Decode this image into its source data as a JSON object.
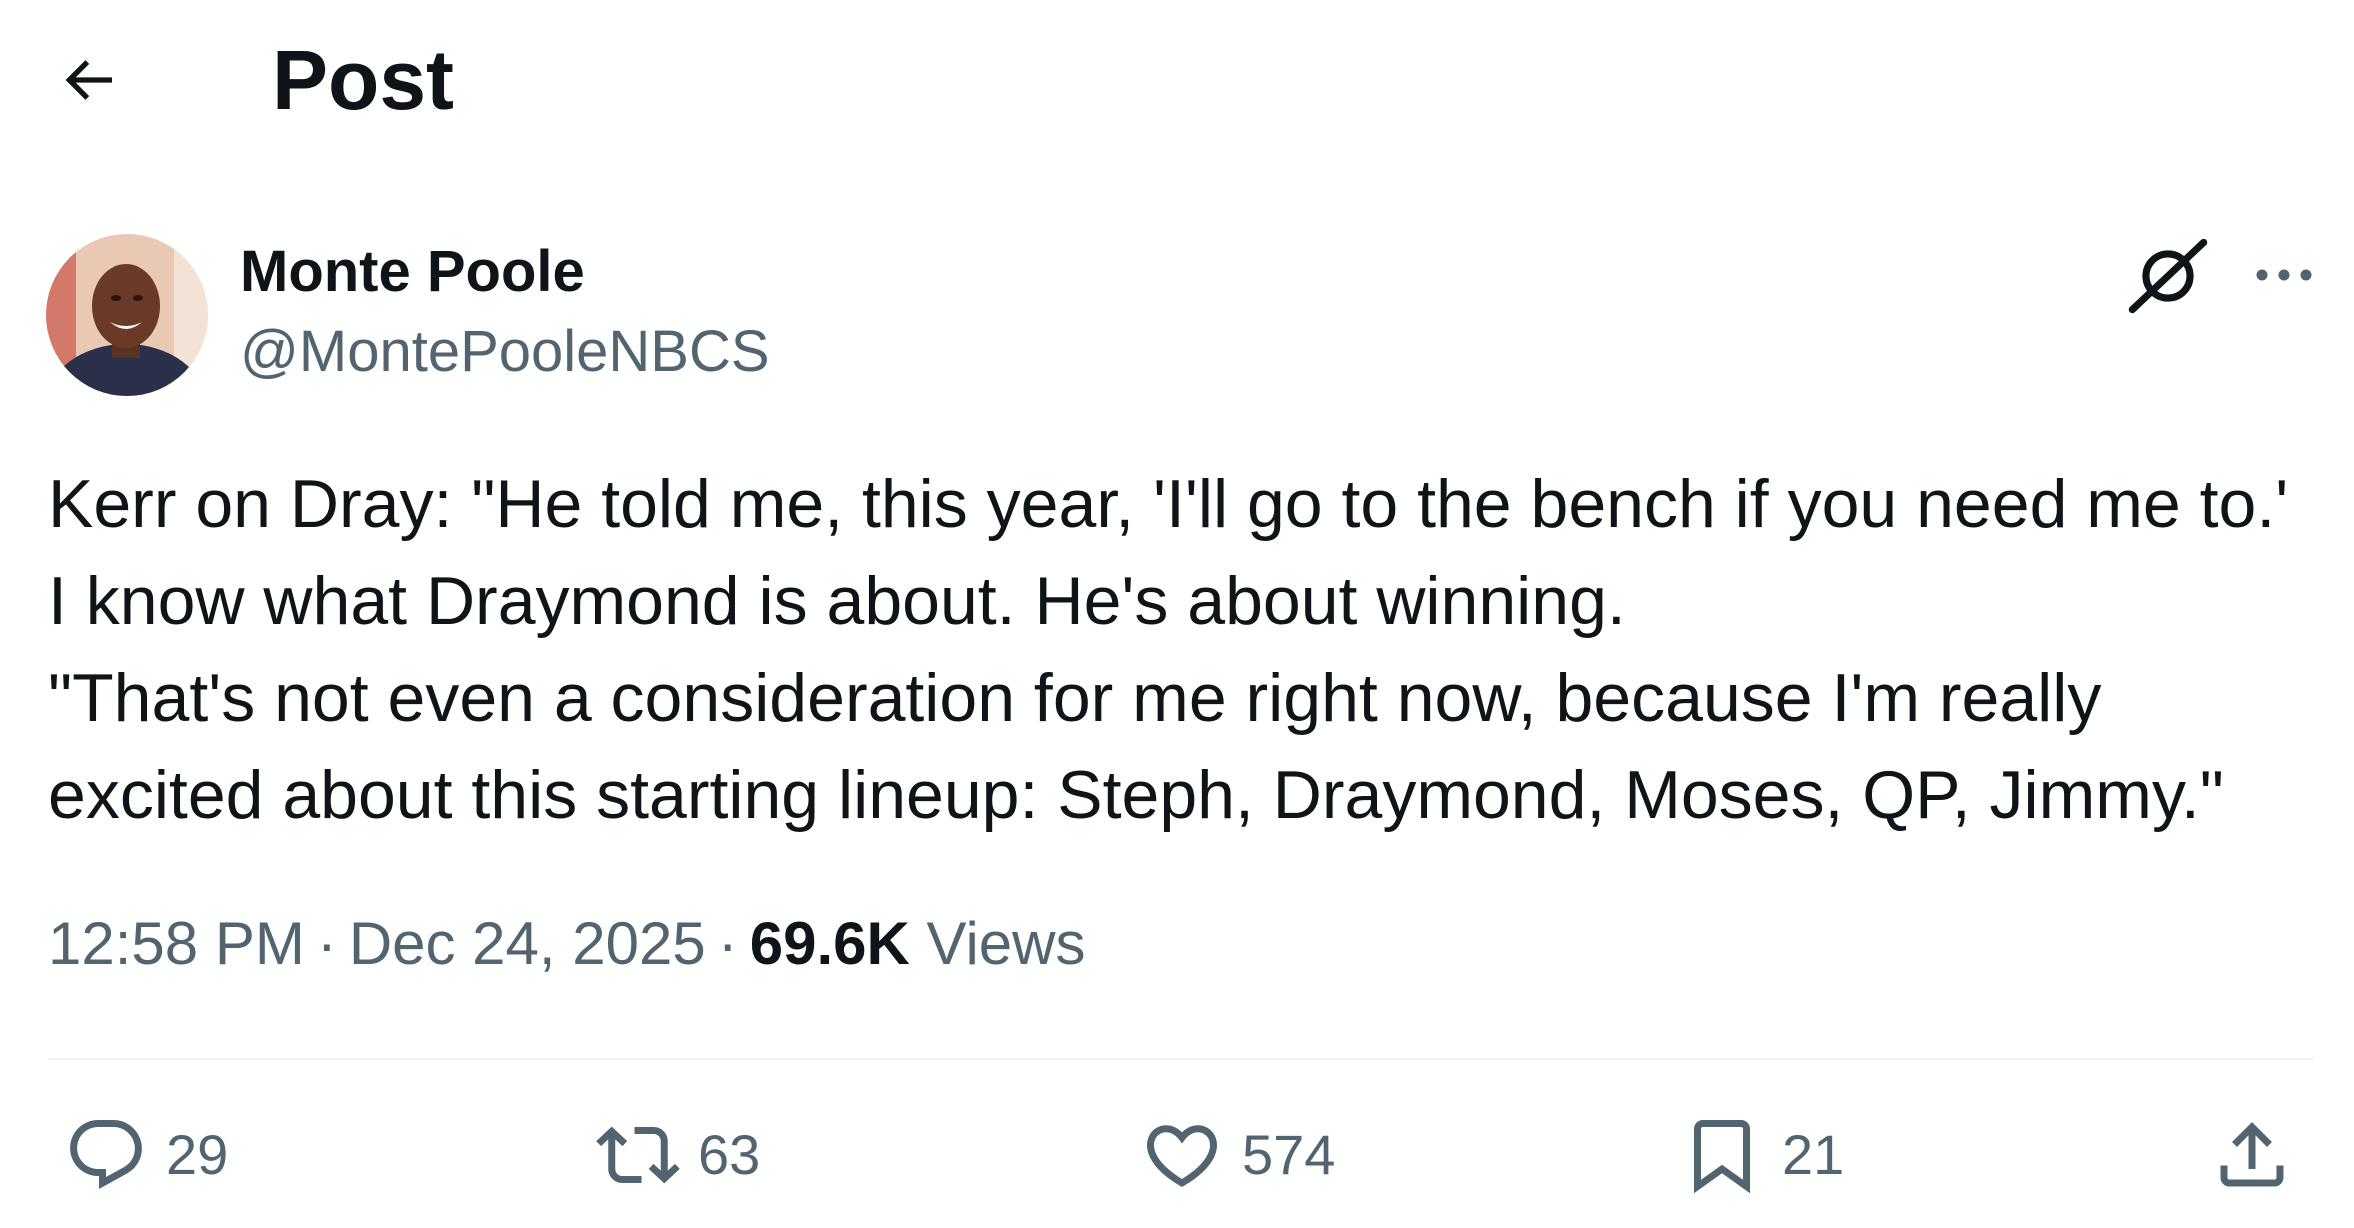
{
  "header": {
    "title": "Post",
    "back_icon": "arrow-left-icon"
  },
  "author": {
    "name": "Monte Poole",
    "handle": "@MontePooleNBCS"
  },
  "tweet": {
    "line1": "Kerr on Dray: \"He told me, this year, 'I'll go to the bench if you need me to.' I know what Draymond is about. He's about winning.",
    "line2": "\"That's not even a consideration for me right now, because I'm really excited about this starting lineup: Steph, Draymond, Moses, QP, Jimmy.\""
  },
  "meta": {
    "time": "12:58 PM",
    "separator": "·",
    "date": "Dec 24, 2025",
    "views_count": "69.6K",
    "views_label": "Views"
  },
  "actions": {
    "replies": "29",
    "reposts": "63",
    "likes": "574",
    "bookmarks": "21"
  },
  "colors": {
    "text_primary": "#0f1419",
    "text_secondary": "#536471",
    "divider": "#eff3f4"
  }
}
